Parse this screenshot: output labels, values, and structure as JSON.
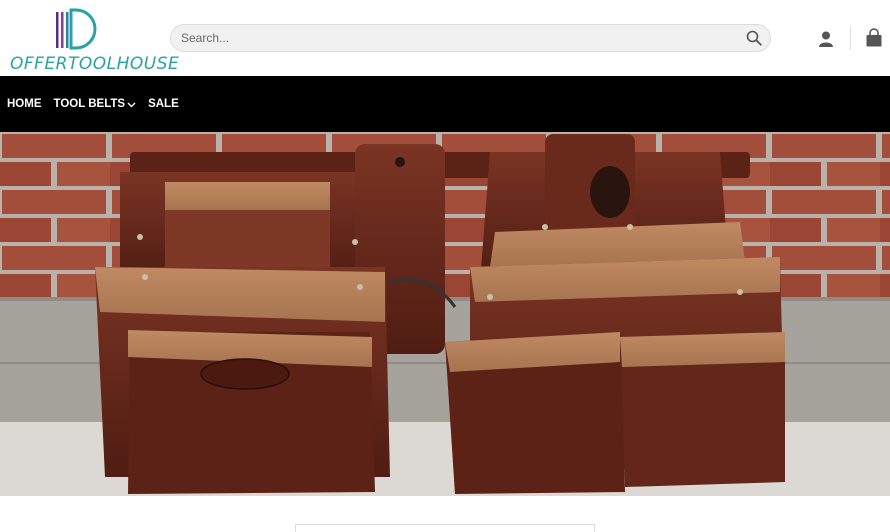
{
  "brand": {
    "name": "OFFERTOOLHOUSE",
    "accent": "#27a3a3"
  },
  "search": {
    "placeholder": "Search...",
    "icon": "search-icon"
  },
  "header_icons": {
    "account": "user-icon",
    "cart": "shopping-bag-icon"
  },
  "nav": {
    "items": [
      {
        "label": "HOME",
        "has_dropdown": false
      },
      {
        "label": "TOOL BELTS",
        "has_dropdown": true
      },
      {
        "label": "SALE",
        "has_dropdown": false
      }
    ]
  },
  "hero": {
    "subject": "leather tool belt with multiple pouches in front of a brick wall"
  },
  "colors": {
    "nav_bg": "#000000",
    "leather": "#6b2a1c",
    "brick": "#a24e3a",
    "suede": "#b9805a"
  }
}
